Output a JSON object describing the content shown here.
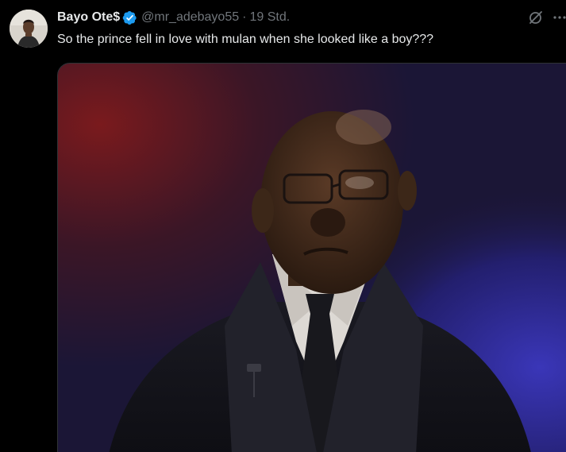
{
  "post": {
    "author": {
      "display_name": "Bayo Ote$",
      "handle": "@mr_adebayo55",
      "verified": true,
      "avatar_icon": "user-avatar"
    },
    "separator": "·",
    "timestamp": "19 Std.",
    "text": "So the prince fell in love with mulan when she looked like a boy???",
    "actions": {
      "grok_icon": "grok-icon",
      "more_icon": "more-icon"
    },
    "media": {
      "type": "video-still",
      "description_icon": "man-in-suit-image"
    }
  },
  "colors": {
    "background": "#000000",
    "text_primary": "#e7e9ea",
    "text_secondary": "#71767b",
    "verified_blue": "#1d9bf0",
    "border": "#2f3336"
  }
}
